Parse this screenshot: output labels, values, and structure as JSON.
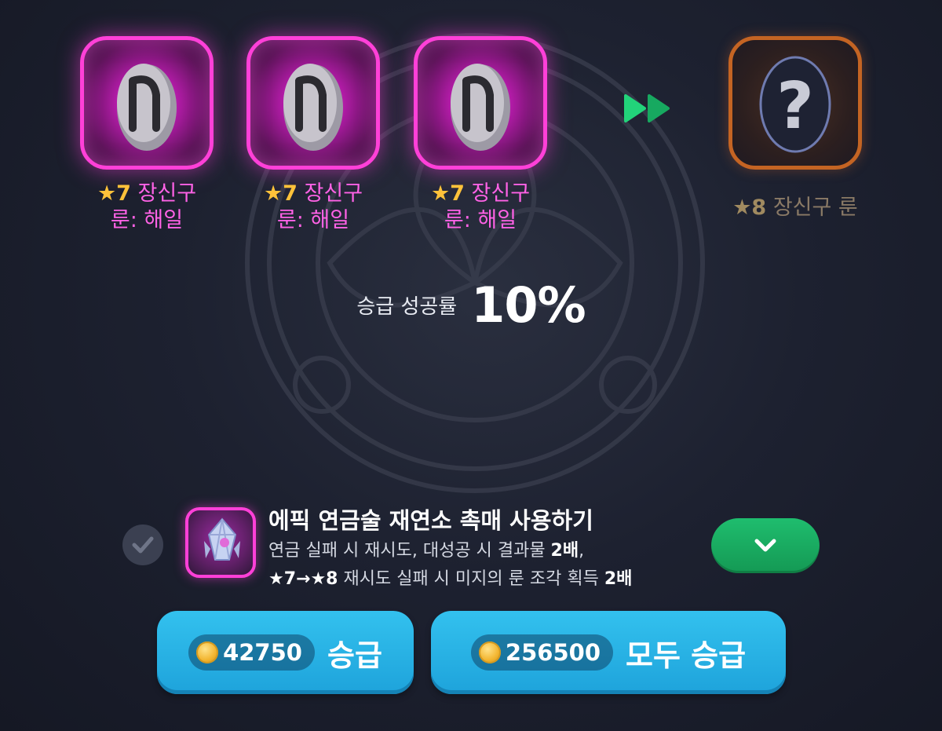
{
  "materials": [
    {
      "stars": "★7",
      "name_line1": "장신구",
      "name_line2": "룬: 해일"
    },
    {
      "stars": "★7",
      "name_line1": "장신구",
      "name_line2": "룬: 해일"
    },
    {
      "stars": "★7",
      "name_line1": "장신구",
      "name_line2": "룬: 해일"
    }
  ],
  "result": {
    "stars": "★8",
    "name": "장신구 룬",
    "icon": "question-mark-icon"
  },
  "success_rate": {
    "label": "승급 성공률",
    "value": "10%"
  },
  "catalyst": {
    "title": "에픽 연금술 재연소 촉매 사용하기",
    "desc_line1_a": "연금 실패 시 재시도, 대성공 시 결과물 ",
    "desc_line1_b": "2배",
    "desc_line1_c": ",",
    "desc_line2_a": "★7→★8",
    "desc_line2_b": " 재시도 실패 시 미지의 룬 조각 획득 ",
    "desc_line2_c": "2배",
    "checked": false
  },
  "buttons": {
    "upgrade": {
      "cost": "42750",
      "label": "승급"
    },
    "upgrade_all": {
      "cost": "256500",
      "label": "모두 승급"
    }
  },
  "colors": {
    "material_border": "#ff40d8",
    "target_border": "#c46423",
    "button_blue": "#1ea3db",
    "expand_green": "#149954",
    "star_gold": "#ffc23a"
  }
}
